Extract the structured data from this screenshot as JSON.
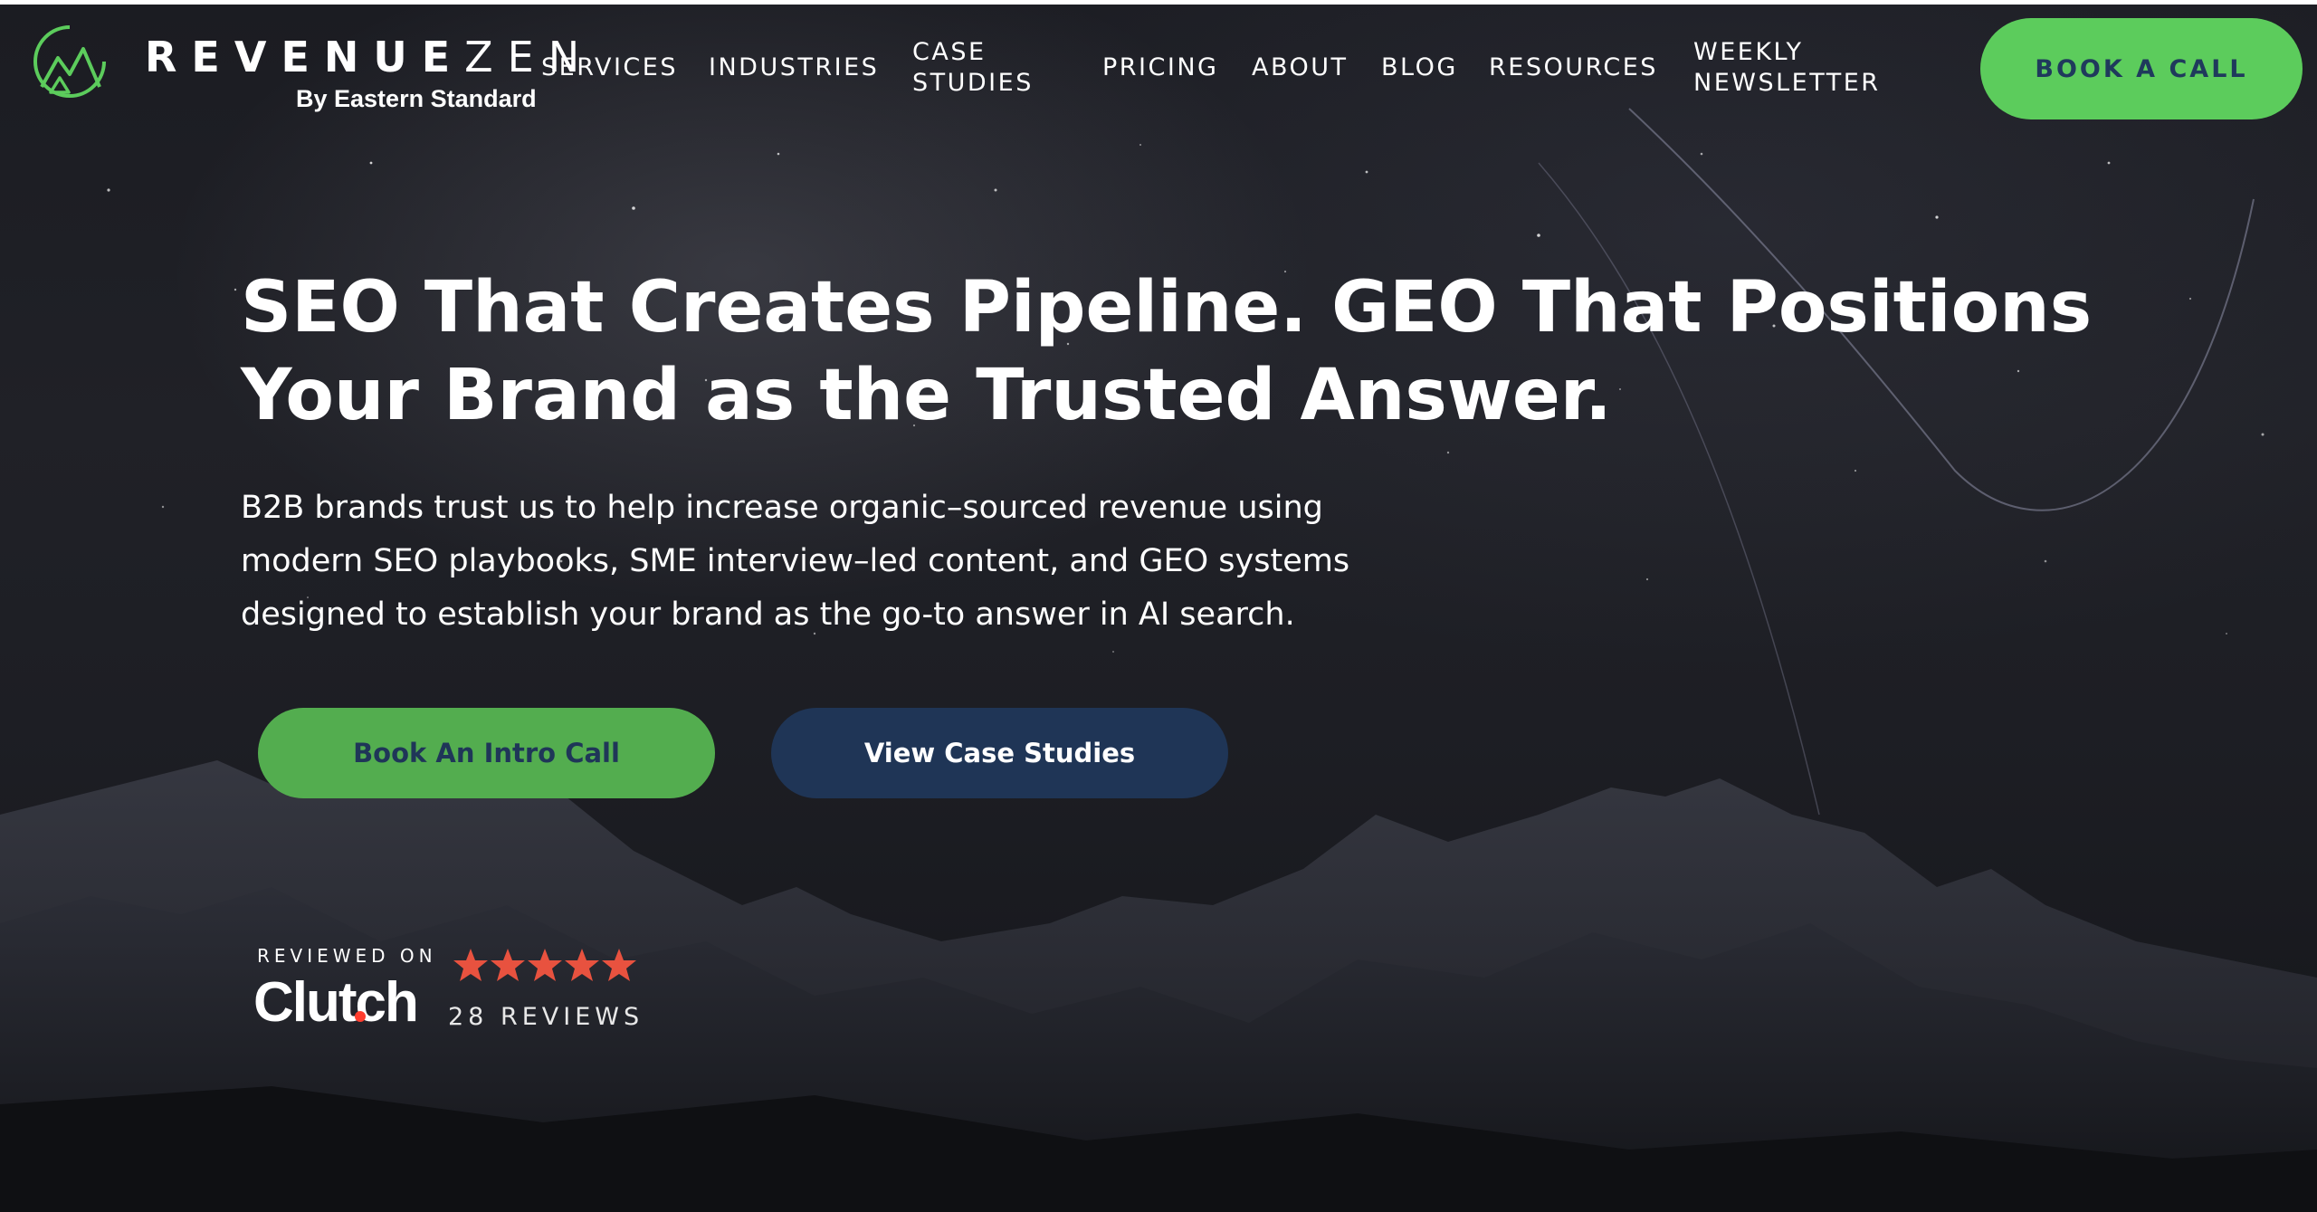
{
  "brand": {
    "name_bold": "REVENUE",
    "name_light": "ZEN",
    "tagline": "By Eastern Standard"
  },
  "nav": {
    "services": "SERVICES",
    "industries": "INDUSTRIES",
    "case_studies_line1": "CASE",
    "case_studies_line2": "STUDIES",
    "pricing": "PRICING",
    "about": "ABOUT",
    "blog": "BLOG",
    "resources": "RESOURCES",
    "newsletter_line1": "WEEKLY",
    "newsletter_line2": "NEWSLETTER",
    "cta": "BOOK A CALL"
  },
  "hero": {
    "title_line1": "SEO That Creates Pipeline. GEO That Positions",
    "title_line2": "Your Brand as the Trusted Answer.",
    "desc_line1": "B2B brands trust us to help increase organic–sourced revenue using",
    "desc_line2": "modern SEO playbooks, SME interview–led content, and GEO systems",
    "desc_line3": "designed to establish your brand as the go-to answer in AI search.",
    "primary_cta": "Book An Intro Call",
    "secondary_cta": "View Case Studies"
  },
  "clutch": {
    "reviewed_on": "REVIEWED ON",
    "logo_text": "Clutch",
    "rating": 5,
    "rating_max": 5,
    "reviews": "28 REVIEWS"
  },
  "colors": {
    "accent_green": "#5ccc5c",
    "button_green": "#53ad4f",
    "navy": "#1f3556",
    "star_red": "#e8523f",
    "clutch_dot": "#ff3d2e"
  }
}
